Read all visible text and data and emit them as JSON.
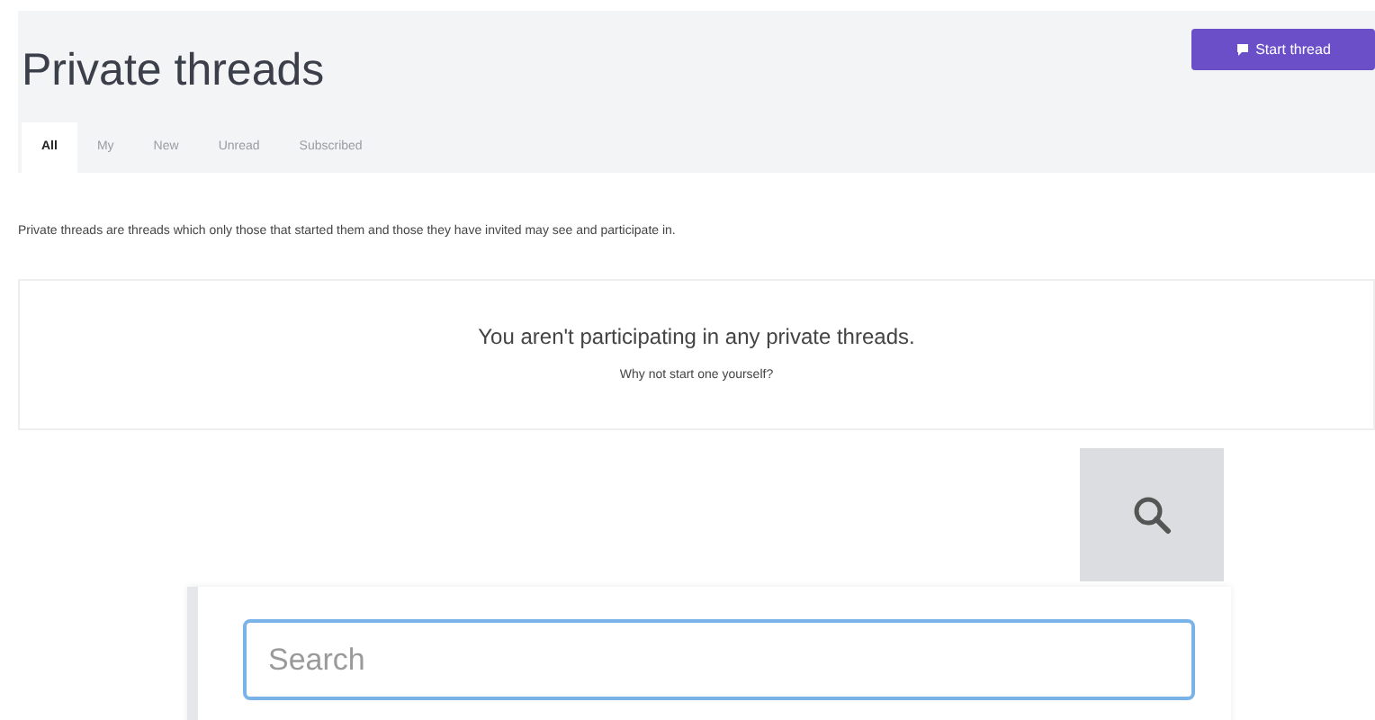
{
  "header": {
    "title": "Private threads",
    "start_button": {
      "label": "Start thread"
    }
  },
  "tabs": [
    {
      "label": "All",
      "selected": true
    },
    {
      "label": "My",
      "selected": false
    },
    {
      "label": "New",
      "selected": false
    },
    {
      "label": "Unread",
      "selected": false
    },
    {
      "label": "Subscribed",
      "selected": false
    }
  ],
  "description": "Private threads are threads which only those that started them and those they have invited may see and participate in.",
  "empty_state": {
    "message": "You aren't participating in any private threads.",
    "hint": "Why not start one yourself?"
  },
  "search": {
    "placeholder": "Search",
    "expanded": true
  }
}
